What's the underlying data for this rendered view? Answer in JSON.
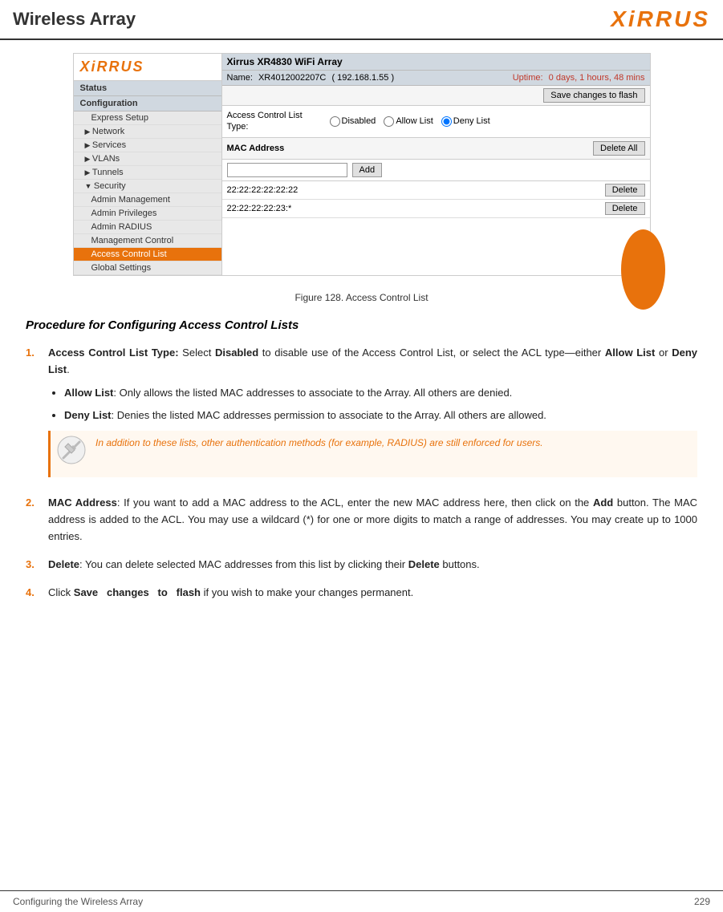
{
  "header": {
    "title": "Wireless Array",
    "logo_text": "XIRRUS"
  },
  "sidebar": {
    "logo": "XIRRUS",
    "status_label": "Status",
    "configuration_label": "Configuration",
    "items": [
      {
        "label": "Express Setup",
        "type": "normal",
        "indented": true
      },
      {
        "label": "Network",
        "type": "arrow",
        "indented": false
      },
      {
        "label": "Services",
        "type": "arrow",
        "indented": false
      },
      {
        "label": "VLANs",
        "type": "arrow",
        "indented": false
      },
      {
        "label": "Tunnels",
        "type": "arrow",
        "indented": false
      },
      {
        "label": "Security",
        "type": "down",
        "indented": false
      },
      {
        "label": "Admin Management",
        "type": "normal",
        "indented": true
      },
      {
        "label": "Admin Privileges",
        "type": "normal",
        "indented": true
      },
      {
        "label": "Admin RADIUS",
        "type": "normal",
        "indented": true
      },
      {
        "label": "Management Control",
        "type": "normal",
        "indented": true
      },
      {
        "label": "Access Control List",
        "type": "normal",
        "indented": true,
        "active": true
      },
      {
        "label": "Global Settings",
        "type": "normal",
        "indented": true
      }
    ]
  },
  "top_bar": {
    "device_title": "Xirrus XR4830 WiFi Array",
    "name_label": "Name:",
    "device_name": "XR4012002207C",
    "ip": "( 192.168.1.55 )",
    "uptime_label": "Uptime:",
    "uptime_value": "0 days, 1 hours, 48 mins",
    "save_button": "Save changes to flash"
  },
  "acl": {
    "type_label": "Access Control List Type:",
    "disabled_label": "Disabled",
    "allow_list_label": "Allow List",
    "deny_list_label": "Deny List",
    "selected": "deny",
    "mac_address_label": "MAC Address",
    "delete_all_button": "Delete All",
    "add_button": "Add",
    "mac_input_placeholder": "",
    "entries": [
      {
        "mac": "22:22:22:22:22:22"
      },
      {
        "mac": "22:22:22:22:23:*"
      }
    ]
  },
  "figure_caption": "Figure 128. Access Control List",
  "procedure": {
    "heading": "Procedure for Configuring Access Control Lists",
    "items": [
      {
        "number": "1.",
        "intro": "Access Control List Type:",
        "text": " Select ",
        "bold1": "Disabled",
        "text2": " to disable use of the Access Control List, or select the ACL type—either ",
        "bold2": "Allow List",
        "text3": " or ",
        "bold3": "Deny List",
        "text4": ".",
        "bullets": [
          {
            "bold": "Allow List",
            "text": ": Only allows the listed MAC addresses to associate to the Array. All others are denied."
          },
          {
            "bold": "Deny List",
            "text": ":  Denies the listed MAC addresses permission to associate to the Array. All others are allowed."
          }
        ],
        "note": "In addition to these lists, other authentication methods (for example, RADIUS) are still enforced for users."
      },
      {
        "number": "2.",
        "bold": "MAC Address",
        "text": ": If you want to add a MAC address to the ACL, enter the new MAC address here, then click on the ",
        "bold2": "Add",
        "text2": " button. The MAC address is added to the ACL. You may use a wildcard (*) for one or more digits to match a range of addresses. You may create up to 1000 entries."
      },
      {
        "number": "3.",
        "bold": "Delete",
        "text": ": You can delete selected MAC addresses from this list by clicking their ",
        "bold2": "Delete",
        "text2": " buttons."
      },
      {
        "number": "4.",
        "text_pre": "Click ",
        "bold": "Save  changes  to  flash",
        "text": " if you wish to make your changes permanent."
      }
    ]
  },
  "footer": {
    "left": "Configuring the Wireless Array",
    "right": "229"
  }
}
